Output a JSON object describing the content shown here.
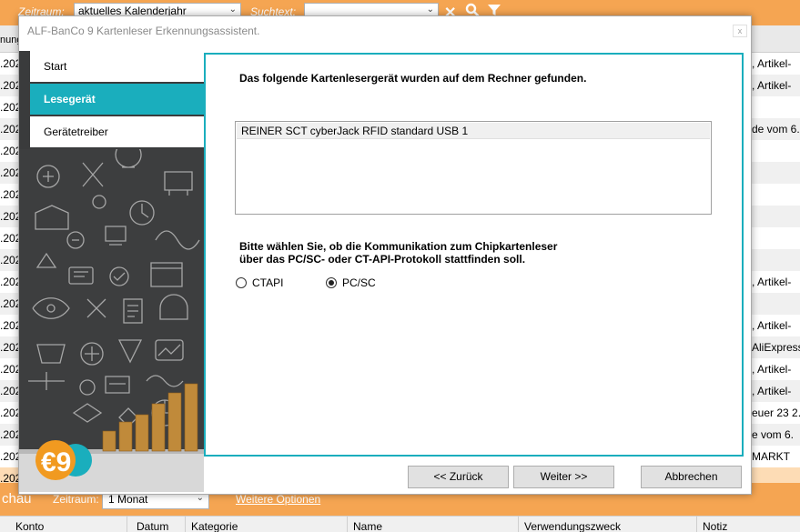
{
  "background": {
    "topbar": {
      "zeitraum_label": "Zeitraum:",
      "zeitraum_value": "aktuelles Kalenderjahr",
      "suchtext_label": "Suchtext:",
      "suchtext_value": ""
    },
    "header_partial": "nung",
    "rows": [
      {
        "left": ".202",
        "right": ", Artikel-"
      },
      {
        "left": ".202",
        "right": ", Artikel-"
      },
      {
        "left": ".202",
        "right": ""
      },
      {
        "left": ".202",
        "right": "de vom 6."
      },
      {
        "left": ".202",
        "right": ""
      },
      {
        "left": ".202",
        "right": ""
      },
      {
        "left": ".202",
        "right": ""
      },
      {
        "left": ".202",
        "right": ""
      },
      {
        "left": ".202",
        "right": ""
      },
      {
        "left": ".202",
        "right": ""
      },
      {
        "left": ".202",
        "right": ", Artikel-"
      },
      {
        "left": ".202",
        "right": ""
      },
      {
        "left": ".202",
        "right": ", Artikel-"
      },
      {
        "left": ".202",
        "right": "AliExpress"
      },
      {
        "left": ".202",
        "right": ", Artikel-"
      },
      {
        "left": ".202",
        "right": ", Artikel-"
      },
      {
        "left": ".202",
        "right": "euer 23 2."
      },
      {
        "left": ".202",
        "right": "e vom 6."
      },
      {
        "left": ".202",
        "right": "MARKT"
      },
      {
        "left": ".202",
        "right": ""
      }
    ],
    "bottombar": {
      "title": "chau",
      "zeitraum_label": "Zeitraum:",
      "zeitraum_value": "1 Monat",
      "link": "Weitere Optionen"
    },
    "bottom_columns": [
      "Konto",
      "Datum",
      "Kategorie",
      "Name",
      "Verwendungszweck",
      "Notiz"
    ]
  },
  "dialog": {
    "title": "ALF-BanCo 9 Kartenleser Erkennungsassistent.",
    "close_label": "x",
    "nav": [
      {
        "label": "Start",
        "active": false
      },
      {
        "label": "Lesegerät",
        "active": true
      },
      {
        "label": "Gerätetreiber",
        "active": false
      }
    ],
    "found_text": "Das folgende Kartenlesergerät wurden auf dem Rechner gefunden.",
    "devices": [
      "REINER SCT cyberJack RFID standard USB 1"
    ],
    "prompt_line1": "Bitte wählen Sie, ob die Kommunikation zum Chipkartenleser",
    "prompt_line2": "über das PC/SC- oder CT-API-Protokoll stattfinden soll.",
    "options": [
      {
        "label": "CTAPI",
        "checked": false
      },
      {
        "label": "PC/SC",
        "checked": true
      }
    ],
    "buttons": {
      "back": "<< Zurück",
      "next": "Weiter >>",
      "cancel": "Abbrechen"
    },
    "logo_text": "€9"
  },
  "colors": {
    "accent_orange": "#f5a552",
    "accent_teal": "#1aaebd",
    "sidebar_dark": "#3a3b3c"
  }
}
